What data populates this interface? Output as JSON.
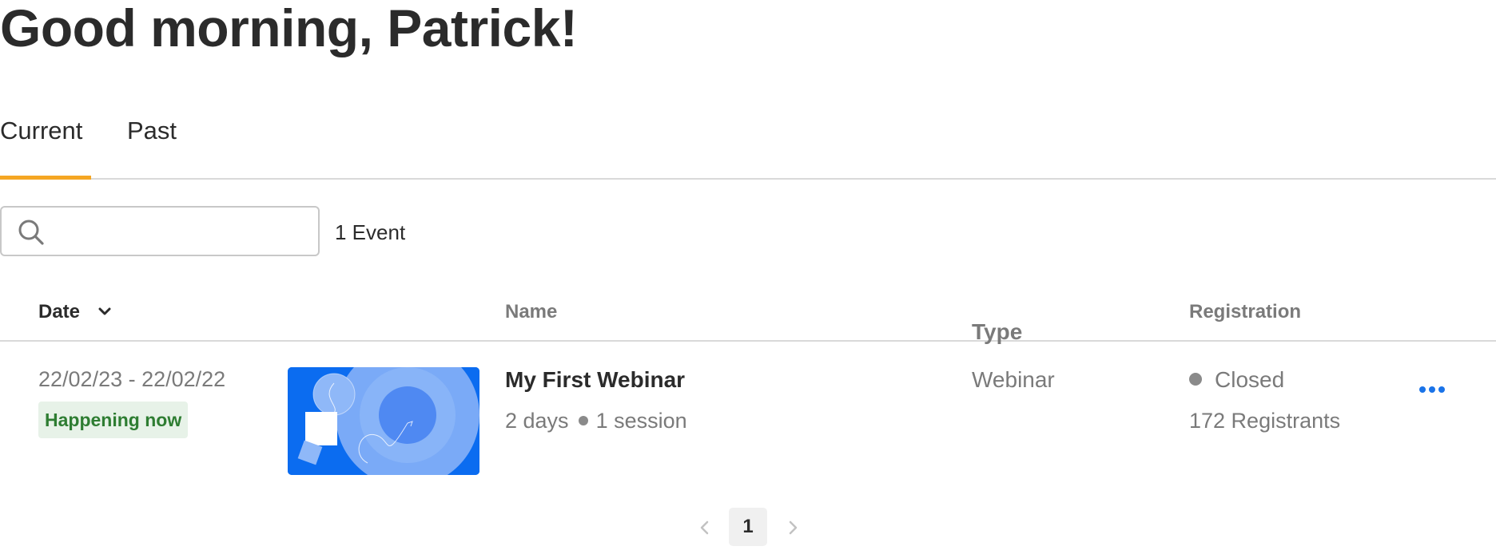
{
  "greeting": "Good morning, Patrick!",
  "tabs": [
    {
      "label": "Current",
      "active": true
    },
    {
      "label": "Past",
      "active": false
    }
  ],
  "search": {
    "value": "",
    "placeholder": "",
    "icon": "search-icon"
  },
  "event_count": "1 Event",
  "table": {
    "headers": {
      "date": "Date",
      "date_sort_icon": "chevron-down-icon",
      "name": "Name",
      "type": "Type",
      "registration": "Registration"
    },
    "rows": [
      {
        "date_range": "22/02/23 - 22/02/22",
        "status_badge": "Happening now",
        "name": "My First Webinar",
        "duration": "2 days",
        "sessions": "1 session",
        "type": "Webinar",
        "registration_status": "Closed",
        "registrants": "172 Registrants",
        "more_icon": "more-horizontal-icon"
      }
    ]
  },
  "pagination": {
    "current_page": "1",
    "prev_icon": "chevron-left-icon",
    "next_icon": "chevron-right-icon"
  },
  "colors": {
    "accent_tab": "#f5a623",
    "badge_bg": "#e7f2e8",
    "badge_text": "#2e7d32",
    "link_blue": "#1a73e8",
    "thumbnail_blue": "#0b6cf0"
  }
}
